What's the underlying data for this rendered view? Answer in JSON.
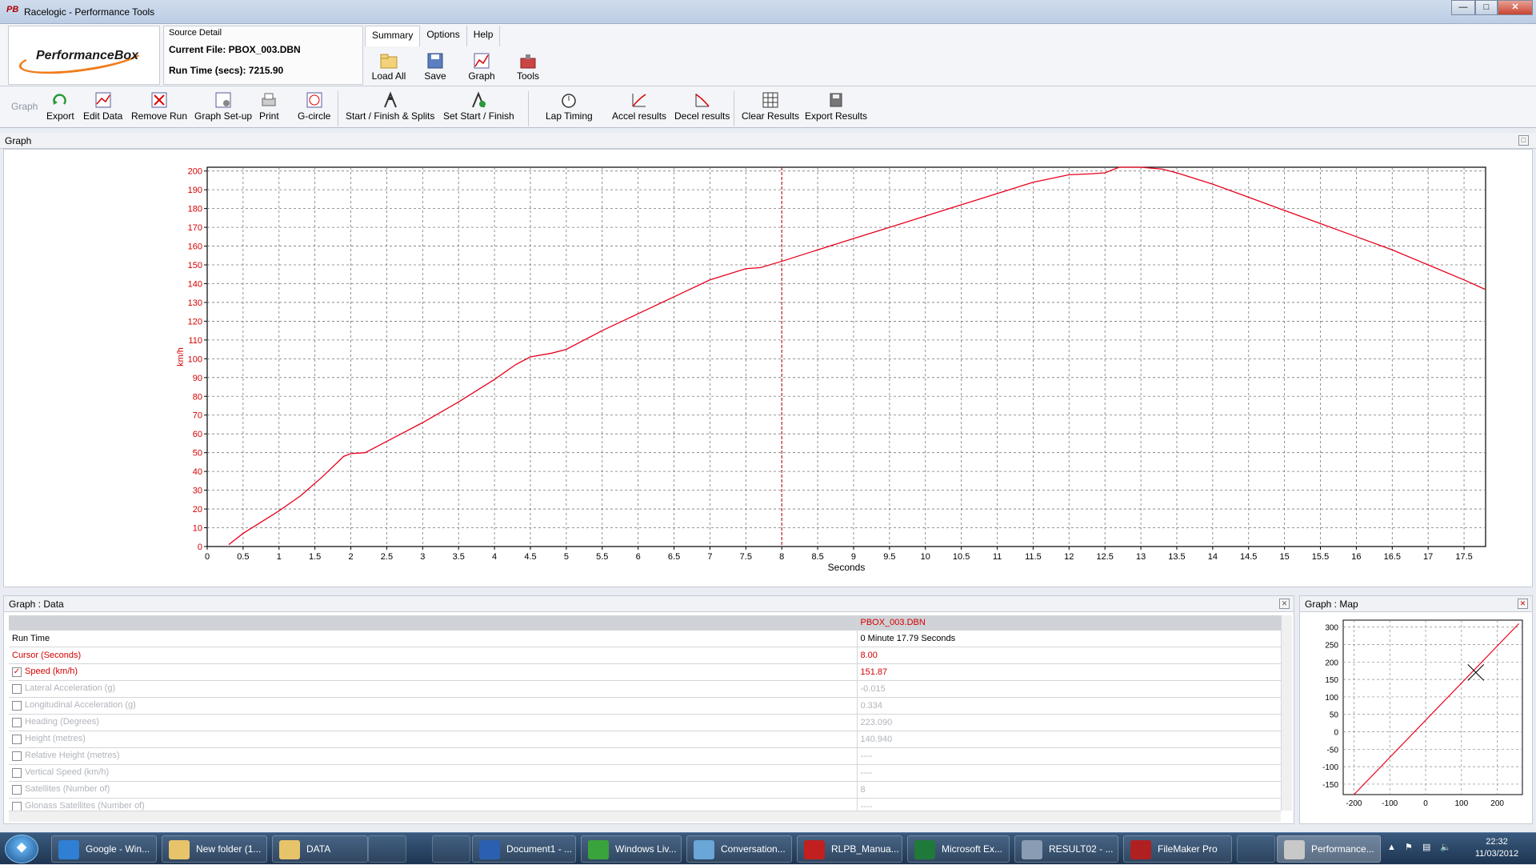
{
  "window": {
    "title": "Racelogic - Performance Tools",
    "app_icon": "PB"
  },
  "header": {
    "logo_text": "PerformanceBox",
    "source_label": "Source Detail",
    "current_file": "Current File: PBOX_003.DBN",
    "run_time": "Run Time (secs): 7215.90"
  },
  "menu": [
    "Summary",
    "Options",
    "Help"
  ],
  "quick_tools": [
    "Load All",
    "Save",
    "Graph",
    "Tools"
  ],
  "ribbon": {
    "group_label": "Graph",
    "tools": [
      "Export",
      "Edit Data",
      "Remove Run",
      "Graph Set-up",
      "Print",
      "G-circle",
      "Start / Finish & Splits",
      "Set Start / Finish",
      "Lap Timing",
      "Accel results",
      "Decel results",
      "Clear Results",
      "Export Results"
    ]
  },
  "graph_panel": {
    "title": "Graph"
  },
  "chart_data": {
    "type": "line",
    "title": "",
    "xlabel": "Seconds",
    "ylabel": "km/h",
    "xlim": [
      0,
      17.8
    ],
    "ylim": [
      0,
      202
    ],
    "x_ticks": [
      "0",
      "0.5",
      "1",
      "1.5",
      "2",
      "2.5",
      "3",
      "3.5",
      "4",
      "4.5",
      "5",
      "5.5",
      "6",
      "6.5",
      "7",
      "7.5",
      "8",
      "8.5",
      "9",
      "9.5",
      "10",
      "10.5",
      "11",
      "11.5",
      "12",
      "12.5",
      "13",
      "13.5",
      "14",
      "14.5",
      "15",
      "15.5",
      "16",
      "16.5",
      "17",
      "17.5"
    ],
    "y_ticks": [
      "0",
      "10",
      "20",
      "30",
      "40",
      "50",
      "60",
      "70",
      "80",
      "90",
      "100",
      "110",
      "120",
      "130",
      "140",
      "150",
      "160",
      "170",
      "180",
      "190",
      "200"
    ],
    "cursor_x": 8.0,
    "series": [
      {
        "color": "#e8001c",
        "x": [
          0.3,
          0.5,
          1.0,
          1.3,
          1.6,
          1.9,
          2.0,
          2.2,
          2.5,
          3.0,
          3.5,
          4.0,
          4.3,
          4.5,
          4.8,
          5.0,
          5.5,
          6.0,
          6.5,
          7.0,
          7.5,
          7.7,
          8.0,
          8.5,
          9.0,
          9.5,
          10.0,
          10.5,
          11.0,
          11.5,
          12.0,
          12.3,
          12.5,
          12.7,
          13.0,
          13.3,
          13.5,
          14.0,
          14.5,
          15.0,
          15.5,
          16.0,
          16.5,
          17.0,
          17.5,
          17.79
        ],
        "y": [
          1,
          7,
          19,
          27,
          37,
          48,
          49.5,
          50,
          56,
          66,
          77,
          89,
          97,
          101,
          103,
          105,
          115,
          124,
          133,
          142,
          148,
          148.5,
          151.9,
          158,
          164,
          170,
          176,
          182,
          188,
          194,
          198,
          198.5,
          199,
          202,
          202,
          201,
          199,
          193,
          186,
          179,
          172,
          165,
          158,
          150,
          142,
          137
        ]
      }
    ]
  },
  "data_panel": {
    "title": "Graph : Data",
    "file_column": "PBOX_003.DBN",
    "rows": [
      {
        "label": "Run Time",
        "value": "0 Minute 17.79 Seconds",
        "checkbox": false,
        "checked": false,
        "style": "normal"
      },
      {
        "label": "Cursor (Seconds)",
        "value": "8.00",
        "checkbox": false,
        "checked": false,
        "style": "red"
      },
      {
        "label": "Speed (km/h)",
        "value": "151.87",
        "checkbox": true,
        "checked": true,
        "style": "red"
      },
      {
        "label": "Lateral Acceleration (g)",
        "value": "-0.015",
        "checkbox": true,
        "checked": false,
        "style": "grey"
      },
      {
        "label": "Longitudinal Acceleration (g)",
        "value": "0.334",
        "checkbox": true,
        "checked": false,
        "style": "grey"
      },
      {
        "label": "Heading (Degrees)",
        "value": "223.090",
        "checkbox": true,
        "checked": false,
        "style": "grey"
      },
      {
        "label": "Height (metres)",
        "value": "140.940",
        "checkbox": true,
        "checked": false,
        "style": "grey"
      },
      {
        "label": "Relative Height (metres)",
        "value": "----",
        "checkbox": true,
        "checked": false,
        "style": "grey"
      },
      {
        "label": "Vertical Speed (km/h)",
        "value": "----",
        "checkbox": true,
        "checked": false,
        "style": "grey"
      },
      {
        "label": "Satellites (Number of)",
        "value": "8",
        "checkbox": true,
        "checked": false,
        "style": "grey"
      },
      {
        "label": "Glonass Satellites (Number of)",
        "value": "----",
        "checkbox": true,
        "checked": false,
        "style": "grey"
      }
    ]
  },
  "map_panel": {
    "title": "Graph : Map",
    "y_ticks": [
      "300",
      "250",
      "200",
      "150",
      "100",
      "50",
      "0",
      "-50",
      "-100",
      "-150"
    ],
    "x_ticks": [
      "-200",
      "-100",
      "0",
      "100",
      "200"
    ],
    "xlim": [
      -230,
      270
    ],
    "ylim": [
      -180,
      320
    ],
    "track": {
      "x": [
        -200,
        260
      ],
      "y": [
        -180,
        310
      ]
    },
    "cursor": {
      "x": 140,
      "y": 170
    }
  },
  "taskbar": {
    "items": [
      {
        "label": "Google - Win...",
        "icon_color": "#2f7fd4"
      },
      {
        "label": "New folder (1...",
        "icon_color": "#e7c46a"
      },
      {
        "label": "DATA",
        "icon_color": "#e7c46a"
      },
      {
        "label": "Document1 - ...",
        "icon_color": "#2b5faf"
      },
      {
        "label": "Windows Liv...",
        "icon_color": "#39a43b"
      },
      {
        "label": "Conversation...",
        "icon_color": "#6aa6d8"
      },
      {
        "label": "RLPB_Manua...",
        "icon_color": "#c22020"
      },
      {
        "label": "Microsoft Ex...",
        "icon_color": "#1f7a3a"
      },
      {
        "label": "RESULT02 - ...",
        "icon_color": "#8a9cb4"
      },
      {
        "label": "FileMaker Pro",
        "icon_color": "#b02020"
      },
      {
        "label": "Performance...",
        "icon_color": "#c8c8c8"
      }
    ],
    "clock_time": "22:32",
    "clock_date": "11/03/2012"
  }
}
